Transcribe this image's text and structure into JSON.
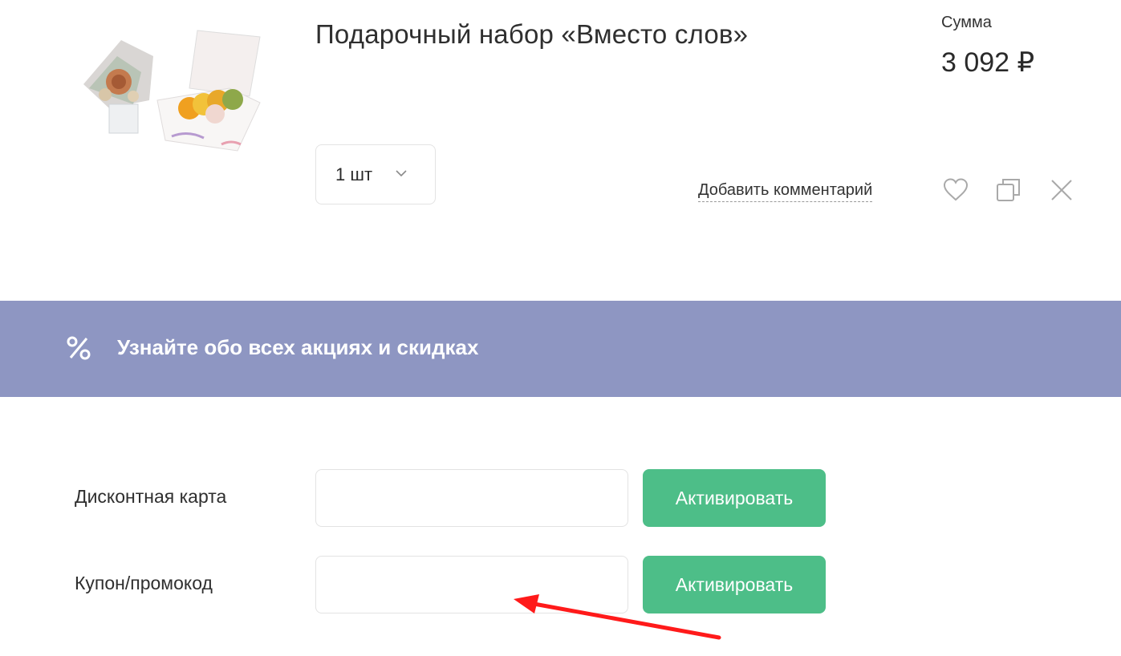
{
  "cart_item": {
    "title": "Подарочный набор «Вместо слов»",
    "image_icon": "gift-box-with-macarons-and-flowers",
    "sum_label": "Сумма",
    "sum_value": "3 092 ₽",
    "quantity": "1 шт",
    "add_comment": "Добавить комментарий",
    "actions": [
      "heart-icon",
      "copy-icon",
      "close-icon"
    ]
  },
  "promo_banner": {
    "icon": "percent-icon",
    "text": "Узнайте обо всех акциях и скидках",
    "background": "#8e96c2"
  },
  "discount_form": {
    "discount_card_label": "Дисконтная карта",
    "discount_card_value": "",
    "coupon_label": "Купон/промокод",
    "coupon_value": "",
    "activate_label": "Активировать",
    "button_color": "#4dbe88"
  },
  "annotation": {
    "arrow_color": "#ff1a1a"
  }
}
